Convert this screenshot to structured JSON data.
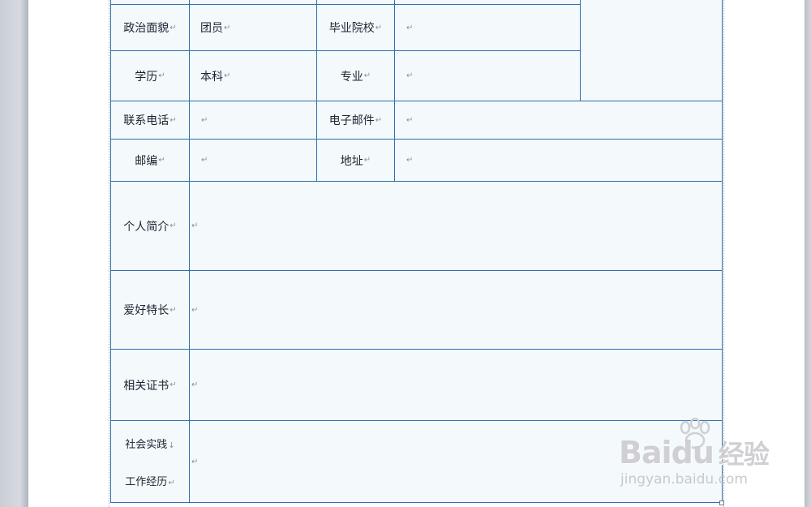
{
  "return_mark": "↵",
  "form": {
    "rows": [
      {
        "label": "政治面貌",
        "value": "团员",
        "label2": "毕业院校",
        "value2": ""
      },
      {
        "label": "学历",
        "value": "本科",
        "label2": "专业",
        "value2": ""
      },
      {
        "label": "联系电话",
        "value": "",
        "label2": "电子邮件",
        "value2": ""
      },
      {
        "label": "邮编",
        "value": "",
        "label2": "地址",
        "value2": ""
      }
    ],
    "sections": [
      {
        "label": "个人简介",
        "value": ""
      },
      {
        "label": "爱好特长",
        "value": ""
      },
      {
        "label": "相关证书",
        "value": ""
      }
    ],
    "last_section": {
      "label_line1": "社会实践",
      "line_break_mark": "↓",
      "label_line2": "工作经历",
      "value": ""
    }
  },
  "watermark": {
    "brand": "Baidu",
    "brand_cn": "经验",
    "url": "jingyan.baidu.com"
  },
  "colors": {
    "table_border": "#2f6fae",
    "cell_fill": "#f4f9fc"
  }
}
